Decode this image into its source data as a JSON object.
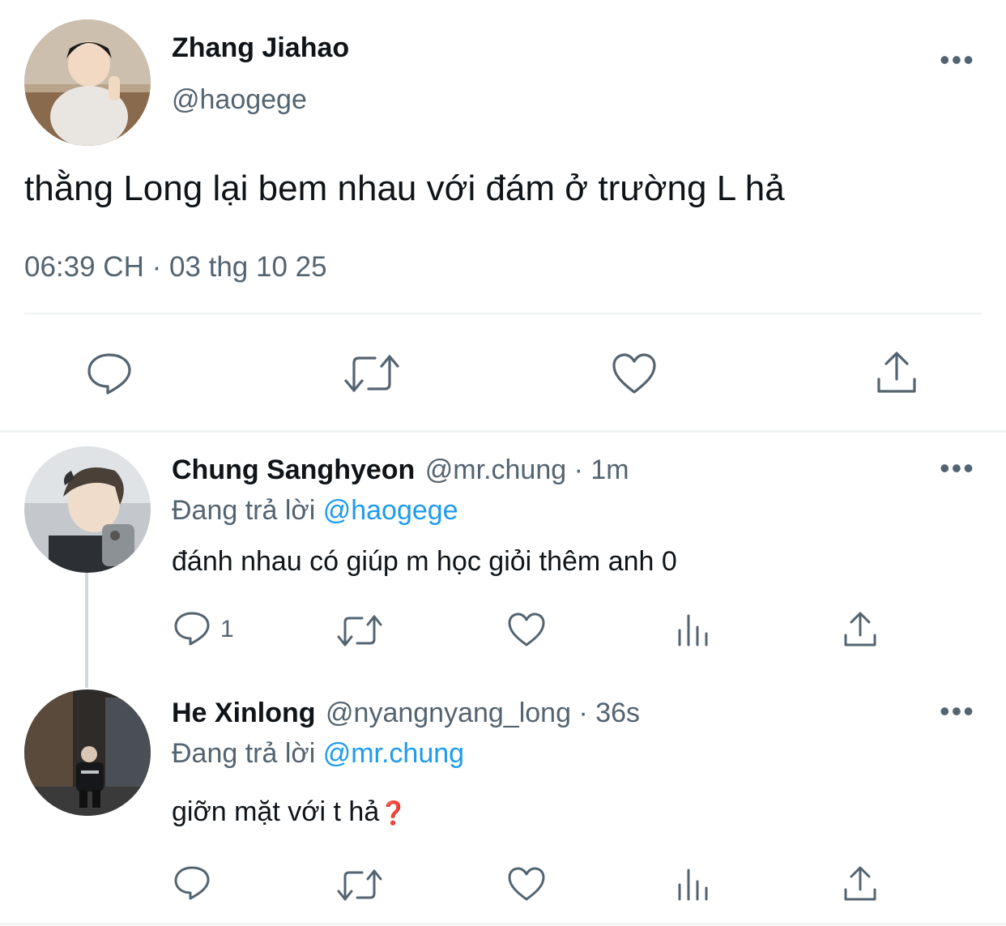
{
  "main_tweet": {
    "display_name": "Zhang Jiahao",
    "handle": "@haogege",
    "text": "thằng Long lại bem nhau với đám ở trường L hả",
    "timestamp": "06:39 CH · 03 thg 10 25",
    "actions": [
      "reply-icon",
      "retweet-icon",
      "like-icon",
      "share-icon"
    ]
  },
  "replies": [
    {
      "display_name": "Chung Sanghyeon",
      "handle_time": "@mr.chung · 1m",
      "replying_prefix": "Đang trả lời ",
      "replying_to": "@haogege",
      "text": "đánh nhau có giúp m học giỏi thêm anh 0",
      "reply_count": "1"
    },
    {
      "display_name": "He Xinlong",
      "handle_time": "@nyangnyang_long · 36s",
      "replying_prefix": "Đang trả lời ",
      "replying_to": "@mr.chung",
      "text": "giỡn mặt với t hả",
      "emoji": "❓"
    }
  ],
  "colors": {
    "text": "#0f1419",
    "secondary": "#536471",
    "accent": "#1d9bf0",
    "divider": "#eff3f4"
  }
}
